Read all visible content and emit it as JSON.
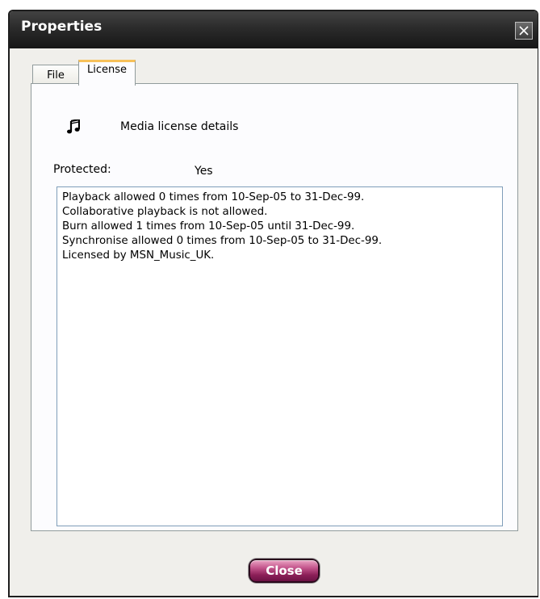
{
  "window": {
    "title": "Properties"
  },
  "tabs": [
    {
      "label": "File",
      "selected": false
    },
    {
      "label": "License",
      "selected": true
    }
  ],
  "license": {
    "header": "Media license details",
    "protected_label": "Protected:",
    "protected_value": "Yes",
    "details": [
      "Playback allowed 0 times from 10-Sep-05 to 31-Dec-99.",
      "Collaborative playback is not allowed.",
      "Burn allowed 1 times from 10-Sep-05 until 31-Dec-99.",
      "Synchronise allowed 0 times from 10-Sep-05 to 31-Dec-99.",
      "Licensed by MSN_Music_UK."
    ]
  },
  "buttons": {
    "close_label": "Close"
  },
  "colors": {
    "titlebar": "#2b2b2b",
    "close_button": "#a3336e",
    "tab_highlight": "#f7c15a"
  },
  "icons": {
    "music": "music-note-icon",
    "window_close": "close-icon"
  }
}
